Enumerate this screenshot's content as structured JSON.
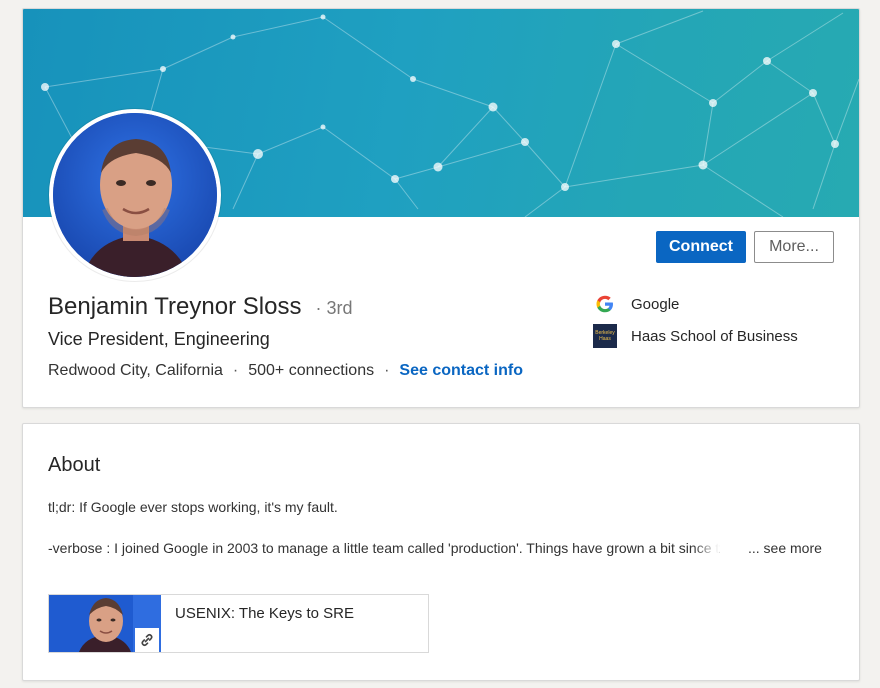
{
  "profile": {
    "name": "Benjamin Treynor Sloss",
    "degree": "· 3rd",
    "headline": "Vice President, Engineering",
    "location": "Redwood City, California",
    "connections": "500+ connections",
    "separator": "·",
    "contact_link": "See contact info",
    "connect_label": "Connect",
    "more_label": "More...",
    "organizations": [
      {
        "name": "Google",
        "icon": "google-logo-icon"
      },
      {
        "name": "Haas School of Business",
        "icon": "haas-logo-icon",
        "logo_text": [
          "Berkeley",
          "Haas"
        ]
      }
    ]
  },
  "about": {
    "title": "About",
    "paragraph1": "tl;dr: If Google ever stops working, it's my fault.",
    "paragraph2": "-verbose : I joined Google in 2003 to manage a little team called 'production'. Things have grown a bit since t",
    "see_more": "... see more",
    "media_title": "USENIX: The Keys to SRE"
  },
  "colors": {
    "accent": "#0a66c2",
    "banner_start": "#1792bb",
    "banner_end": "#27aab2"
  }
}
